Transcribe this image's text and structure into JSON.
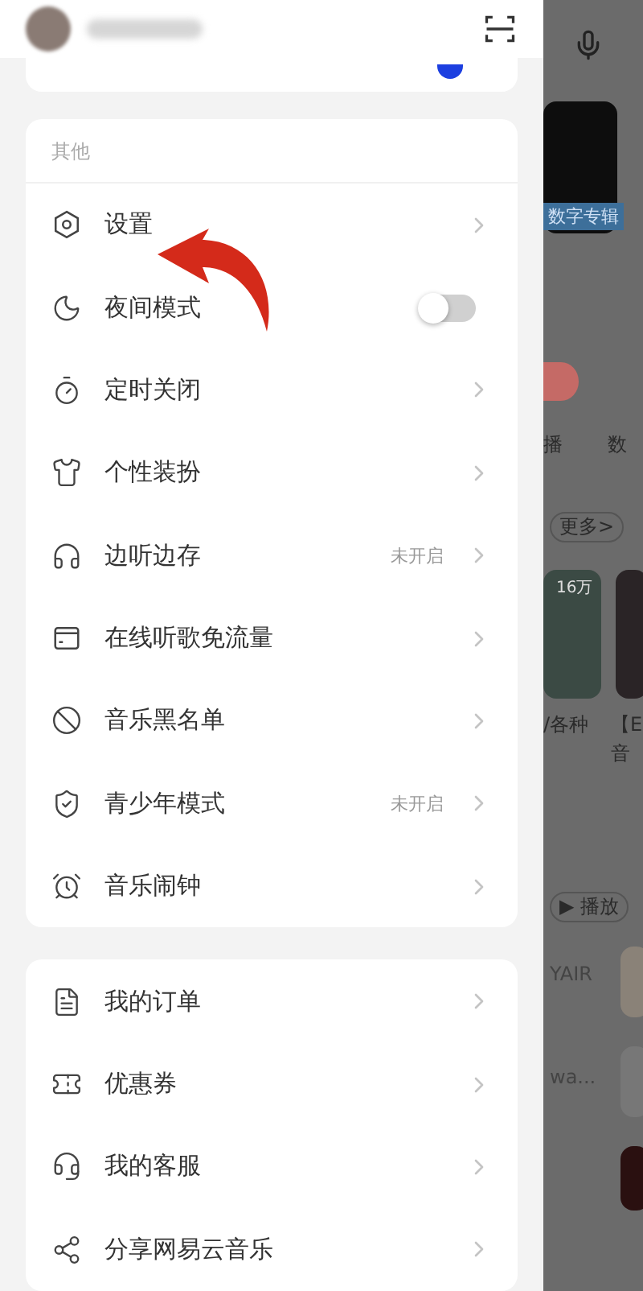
{
  "section": {
    "title": "其他",
    "items": [
      {
        "label": "设置",
        "kind": "link"
      },
      {
        "label": "夜间模式",
        "kind": "toggle",
        "on": false
      },
      {
        "label": "定时关闭",
        "kind": "link"
      },
      {
        "label": "个性装扮",
        "kind": "link"
      },
      {
        "label": "边听边存",
        "kind": "link",
        "status": "未开启"
      },
      {
        "label": "在线听歌免流量",
        "kind": "link"
      },
      {
        "label": "音乐黑名单",
        "kind": "link"
      },
      {
        "label": "青少年模式",
        "kind": "link",
        "status": "未开启"
      },
      {
        "label": "音乐闹钟",
        "kind": "link"
      }
    ]
  },
  "account": {
    "items": [
      {
        "label": "我的订单"
      },
      {
        "label": "优惠券"
      },
      {
        "label": "我的客服"
      },
      {
        "label": "分享网易云音乐"
      }
    ]
  },
  "background": {
    "album_caption": "数字专辑",
    "shortcut_1": "播",
    "shortcut_2": "数",
    "more": "更多>",
    "play_count": "16万",
    "playlist_1": "/各种",
    "playlist_2": "【E",
    "playlist_2_line_2": "音",
    "play": "▶ 播放",
    "song_1": "YAIR",
    "song_2": "wa..."
  }
}
